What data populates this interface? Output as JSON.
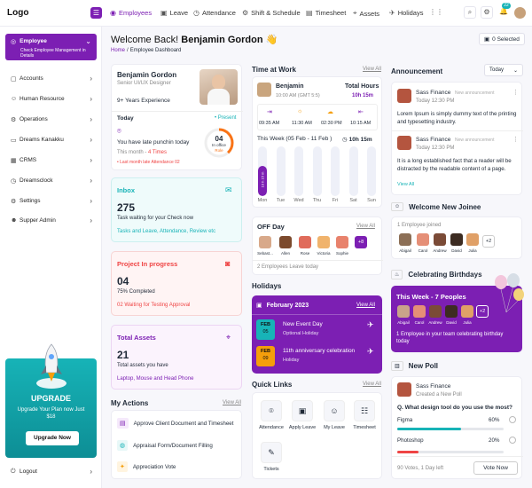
{
  "app": {
    "logo": "Logo"
  },
  "nav": [
    {
      "label": "Employees",
      "icon": "user-group-icon"
    },
    {
      "label": "Leave",
      "icon": "calendar-icon"
    },
    {
      "label": "Attendance",
      "icon": "clock-icon"
    },
    {
      "label": "Shift & Schedule",
      "icon": "settings-icon"
    },
    {
      "label": "Timesheet",
      "icon": "document-icon"
    },
    {
      "label": "Assets",
      "icon": "mouse-icon"
    },
    {
      "label": "Holidays",
      "icon": "plane-icon"
    }
  ],
  "topbar": {
    "notification_count": "22"
  },
  "sidebar": {
    "active_title": "Employee",
    "active_subtitle": "Check Employee Management in Details",
    "items": [
      "Accounts",
      "Human Resource",
      "Operations",
      "Dreams Kanakku",
      "CRMS",
      "Dreamsclock",
      "Settings",
      "Supper Admin"
    ],
    "upgrade_title": "UPGRADE",
    "upgrade_text": "Upgrade Your Plan now Just $18",
    "upgrade_button": "Upgrade Now",
    "logout": "Logout"
  },
  "header": {
    "welcome": "Welcome Back!",
    "name": "Benjamin Gordon",
    "wave": "👋",
    "breadcrumb_home": "Home",
    "breadcrumb_sep": "/",
    "breadcrumb_page": "Employee Dashboard",
    "selected": "0 Selected"
  },
  "profile": {
    "name": "Benjamin Gordon",
    "role": "Senior UI/UX Designer",
    "experience": "9+ Years Experience",
    "today": "Today",
    "present": "• Present",
    "punch_text": "You have late punchin today",
    "this_month": "This month - ",
    "times": "4 Times",
    "last_month": "• Last month late Attendance 02",
    "ring_value": "04",
    "ring_label": "In office",
    "ring_sub": "Role"
  },
  "inbox": {
    "title": "Inbox",
    "count": "275",
    "text": "Task waiting for your Check now",
    "link": "Tasks and Leave, Attendance, Review etc"
  },
  "project": {
    "title": "Project In progress",
    "count": "04",
    "text": "75% Completed",
    "link": "02 Waiting for Testing Approval"
  },
  "assets": {
    "title": "Total Assets",
    "count": "21",
    "text": "Total assets you have",
    "link": "Laptop, Mouse and Head Phone"
  },
  "actions": {
    "title": "My Actions",
    "view_all": "View All",
    "items": [
      "Approve Client Document and Timesheet",
      "Appraisal Form/Document Filling",
      "Appreciation Vote"
    ]
  },
  "time_at_work": {
    "title": "Time at Work",
    "view_all": "View All",
    "name": "Benjamin",
    "shift": "10:00 AM (GMT 5:5)",
    "total_label": "Total Hours",
    "total_value": "10h 15m",
    "slots": [
      "09:35 AM",
      "11:30 AM",
      "02:30 PM",
      "10:15 AM"
    ],
    "week_label": "This Week (05 Feb - 11 Feb )",
    "week_value": "10h 15m",
    "days": [
      "Mon",
      "Tue",
      "Wed",
      "Thu",
      "Fri",
      "Sat",
      "Sun"
    ],
    "mon_label": "10 h 15 m",
    "mon_fill": 0.6
  },
  "offday": {
    "title": "OFF Day",
    "view_all": "View All",
    "people": [
      "Sebast...",
      "Allen",
      "Rose",
      "Victoria",
      "Sophie"
    ],
    "more": "+8",
    "footer": "2 Employees Leave today"
  },
  "holidays": {
    "title": "Holidays",
    "month": "February 2023",
    "view_all": "View All",
    "items": [
      {
        "month": "FEB",
        "day": "05",
        "name": "New Event Day",
        "type": "Optional Holiday"
      },
      {
        "month": "FEB",
        "day": "09",
        "name": "11th anniversary celebration",
        "type": "Holiday"
      }
    ]
  },
  "quick_links": {
    "title": "Quick Links",
    "view_all": "View All",
    "items": [
      "Attendance",
      "Apply Leave",
      "My Leave",
      "Timesheet",
      "Tickets"
    ]
  },
  "announcement": {
    "title": "Announcement",
    "filter": "Today",
    "view_all": "View All",
    "items": [
      {
        "name": "Sass Finance",
        "tag": "New announcement",
        "time": "Today 12:30 PM",
        "text": "Lorem Ipsum is simply dummy text of the printing and typesetting industry."
      },
      {
        "name": "Sass Finance",
        "tag": "New announcement",
        "time": "Today 12:30 PM",
        "text": "It is a long established fact that a reader will be distracted by the readable content of a page."
      }
    ]
  },
  "joinee": {
    "title": "Welcome New Joinee",
    "text": "1 Employee joined",
    "people": [
      "Abigail",
      "Carol",
      "Andrew",
      "David",
      "Julia"
    ],
    "more": "+2"
  },
  "birthdays": {
    "title": "Celebrating Birthdays",
    "week": "This Week - 7 Peoples",
    "people": [
      "Abigail",
      "Carol",
      "Andrew",
      "David",
      "Julia"
    ],
    "more": "+2",
    "text": "1 Employee in your team celebrating birthday today"
  },
  "poll": {
    "title": "New Poll",
    "name": "Sass Finance",
    "sub": "Created a New Poll",
    "question": "Q. What design tool do you use the most?",
    "options": [
      {
        "label": "Figma",
        "value": "60%",
        "fill": 0.6,
        "color": "#17b3b7"
      },
      {
        "label": "Photoshop",
        "value": "20%",
        "fill": 0.2,
        "color": "#ef4444"
      }
    ],
    "votes": "90 Votes, 1 Day left",
    "button": "Vote Now"
  }
}
